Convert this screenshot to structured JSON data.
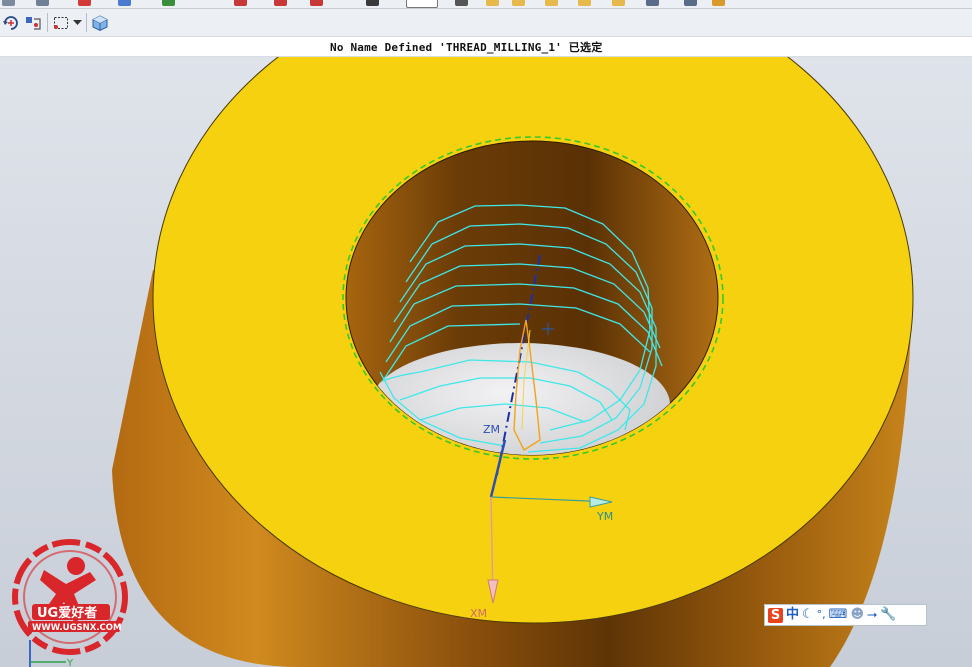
{
  "status": {
    "message": "No Name Defined 'THREAD_MILLING_1' 已选定"
  },
  "toolbar": {
    "items": [
      {
        "name": "rotate-view-icon"
      },
      {
        "name": "snap-point-icon"
      },
      {
        "name": "selection-box-icon"
      },
      {
        "name": "selection-dropdown-icon"
      },
      {
        "name": "shaded-cube-icon"
      }
    ]
  },
  "viewport": {
    "csys_labels": {
      "zm": "ZM",
      "ym": "YM",
      "xm": "XM"
    },
    "wcs_label": "Y",
    "part_color": "#f6d10f",
    "toolpath_color": "#3fe8e8",
    "boundary_color": "#36c92a"
  },
  "watermark": {
    "brand": "UG爱好者",
    "url": "WWW.UGSNX.COM"
  },
  "ime_bar": {
    "items": [
      "S",
      "中",
      "☾",
      "°,",
      "⌨",
      "☻",
      "⭢",
      "🔧"
    ]
  },
  "colors": {
    "accent_blue": "#1f5fbf",
    "ime_red": "#e8431c"
  }
}
